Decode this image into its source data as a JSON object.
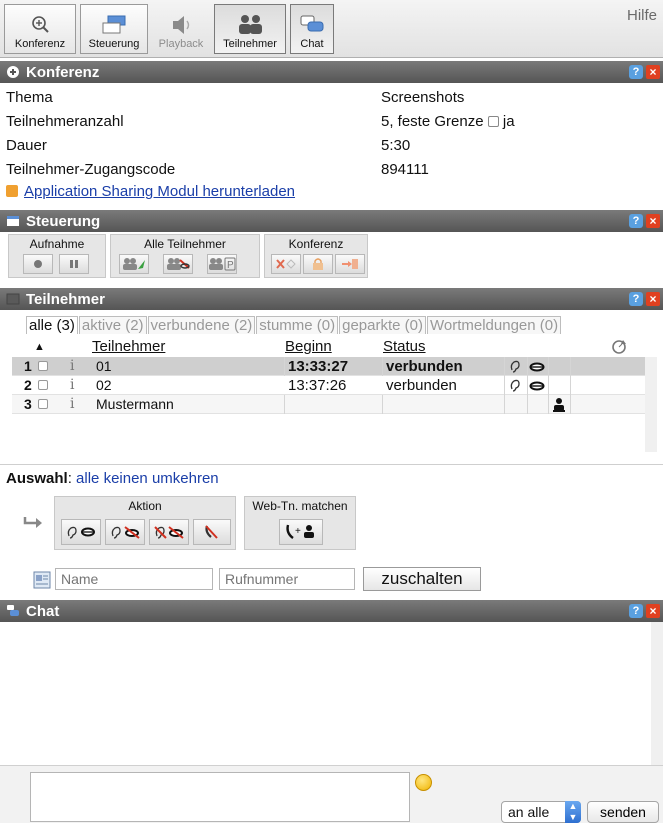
{
  "toolbar": {
    "buttons": [
      {
        "label": "Konferenz",
        "icon": "magnifier-plus-icon"
      },
      {
        "label": "Steuerung",
        "icon": "window-panel-icon"
      },
      {
        "label": "Playback",
        "icon": "speaker-icon"
      },
      {
        "label": "Teilnehmer",
        "icon": "people-icon"
      },
      {
        "label": "Chat",
        "icon": "chat-bubbles-icon"
      }
    ],
    "help": "Hilfe"
  },
  "konferenz": {
    "title": "Konferenz",
    "rows": [
      {
        "key": "Thema",
        "value": "Screenshots"
      },
      {
        "key": "Teilnehmeranzahl",
        "value": "5, feste Grenze",
        "checkbox_label": "ja"
      },
      {
        "key": "Dauer",
        "value": "5:30"
      },
      {
        "key": "Teilnehmer-Zugangscode",
        "value": "894111"
      }
    ],
    "download_link": "Application Sharing Modul herunterladen"
  },
  "steuerung": {
    "title": "Steuerung",
    "groups": {
      "aufnahme": "Aufnahme",
      "alle": "Alle Teilnehmer",
      "konferenz": "Konferenz"
    }
  },
  "teilnehmer": {
    "title": "Teilnehmer",
    "filters": [
      "alle (3)",
      "aktive (2)",
      "verbundene (2)",
      "stumme (0)",
      "geparkte (0)",
      "Wortmeldungen (0)"
    ],
    "columns": {
      "sort": "▲",
      "name": "Teilnehmer",
      "begin": "Beginn",
      "status": "Status"
    },
    "rows": [
      {
        "num": "1",
        "info": "i",
        "name": "01",
        "begin": "13:33:27",
        "status": "verbunden"
      },
      {
        "num": "2",
        "info": "i",
        "name": "02",
        "begin": "13:37:26",
        "status": "verbunden"
      },
      {
        "num": "3",
        "info": "i",
        "name": "Mustermann",
        "begin": "",
        "status": ""
      }
    ]
  },
  "auswahl": {
    "label": "Auswahl",
    "colon": ":",
    "links": [
      "alle",
      "keinen",
      "umkehren"
    ],
    "aktion_title": "Aktion",
    "webtn_title": "Web-Tn. matchen"
  },
  "add": {
    "name_placeholder": "Name",
    "phone_placeholder": "Rufnummer",
    "button": "zuschalten"
  },
  "chat": {
    "title": "Chat",
    "recipient": "an alle",
    "send": "senden"
  },
  "header_controls": {
    "help": "?",
    "close": "×"
  },
  "colors": {
    "header_bg": "#666666",
    "link": "#1a3ea8",
    "help_blue": "#5aa0e0",
    "close_red": "#e04020"
  }
}
